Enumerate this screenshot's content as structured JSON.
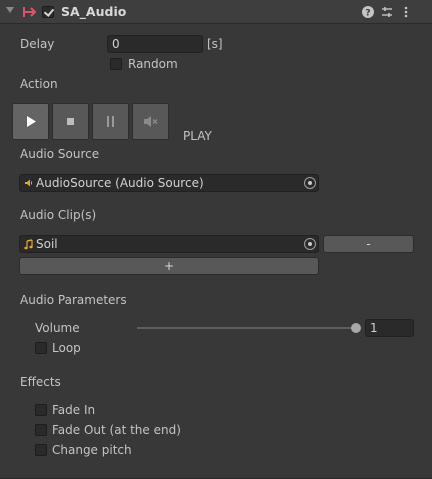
{
  "header": {
    "title": "SA_Audio",
    "enabled": true
  },
  "delay": {
    "label": "Delay",
    "value": "0",
    "unit": "[s]",
    "random_label": "Random"
  },
  "action": {
    "label": "Action",
    "buttons": [
      "play",
      "stop",
      "pause",
      "mute"
    ],
    "status": "PLAY"
  },
  "audio_source": {
    "label": "Audio Source",
    "value": "AudioSource (Audio Source)"
  },
  "audio_clips": {
    "label": "Audio Clip(s)",
    "items": [
      "Soil"
    ],
    "remove_label": "-",
    "add_label": "+"
  },
  "audio_parameters": {
    "label": "Audio Parameters",
    "volume_label": "Volume",
    "volume_value": "1",
    "volume_fraction": 1.0,
    "loop_label": "Loop"
  },
  "effects": {
    "label": "Effects",
    "fade_in_label": "Fade In",
    "fade_out_label": "Fade Out (at the end)",
    "change_pitch_label": "Change pitch"
  },
  "colors": {
    "background": "#383838",
    "header": "#3e3e3e",
    "field": "#2a2a2a",
    "button": "#585858",
    "script_icon": "#e0516a"
  }
}
